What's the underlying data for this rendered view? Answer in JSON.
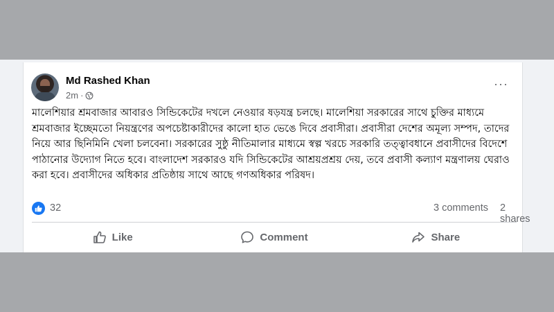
{
  "post": {
    "author": "Md Rashed Khan",
    "time": "2m",
    "visibility_icon": "globe-icon",
    "more_icon": "ellipsis-icon",
    "more_label": "···",
    "text": "মালেশিয়ার শ্রমবাজার আবারও সিন্ডিকেটের দখলে নেওয়ার ষড়যন্ত্র চলছে। মালেশিয়া সরকারের সাথে চুক্তির মাধ্যমে শ্রমবাজার ইচ্ছেমতো নিয়ন্ত্রণের অপচেষ্টাকারীদের কালো হাত ভেঙে দিবে প্রবাসীরা। প্রবাসীরা দেশের অমূল্য সম্পদ, তাদের নিয়ে আর ছিনিমিনি খেলা চলবেনা। সরকারের সুষ্ঠু নীতিমালার মাধ্যমে স্বল্প খরচে সরকারি তত্ত্বাবধানে প্রবাসীদের বিদেশে পাঠানোর উদ্যোগ নিতে হবে। বাংলাদেশ সরকারও যদি সিন্ডিকেটের আশ্রয়প্রশ্রয় দেয়, তবে প্রবাসী কল্যাণ মন্ত্রণালয় ঘেরাও করা হবে। প্রবাসীদের অধিকার প্রতিষ্ঠায় সাথে আছে গণঅধিকার পরিষদ।",
    "reactions": {
      "icon": "thumbs-up-icon",
      "color": "#1877f2",
      "count": "32"
    },
    "comments": "3 comments",
    "shares": "2 shares"
  },
  "actions": {
    "like": "Like",
    "comment": "Comment",
    "share": "Share"
  },
  "colors": {
    "background": "#a6a8ab",
    "card": "#ffffff",
    "secondary_text": "#65676b",
    "accent": "#1877f2"
  }
}
